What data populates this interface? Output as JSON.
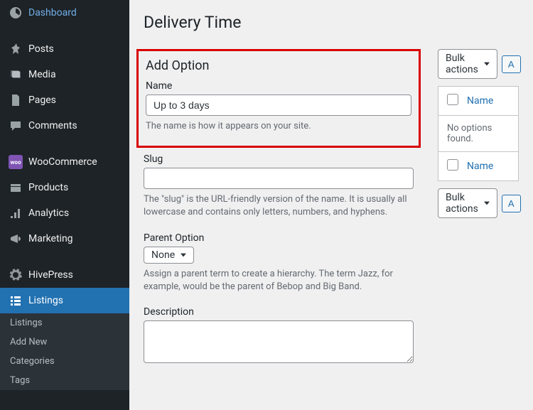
{
  "sidebar": {
    "items": [
      {
        "label": "Dashboard"
      },
      {
        "label": "Posts"
      },
      {
        "label": "Media"
      },
      {
        "label": "Pages"
      },
      {
        "label": "Comments"
      },
      {
        "label": "WooCommerce"
      },
      {
        "label": "Products"
      },
      {
        "label": "Analytics"
      },
      {
        "label": "Marketing"
      },
      {
        "label": "HivePress"
      },
      {
        "label": "Listings"
      }
    ],
    "sub": [
      {
        "label": "Listings"
      },
      {
        "label": "Add New"
      },
      {
        "label": "Categories"
      },
      {
        "label": "Tags"
      }
    ]
  },
  "page": {
    "title": "Delivery Time",
    "section_heading": "Add Option",
    "name_label": "Name",
    "name_value": "Up to 3 days",
    "name_help": "The name is how it appears on your site.",
    "slug_label": "Slug",
    "slug_value": "",
    "slug_help": "The \"slug\" is the URL-friendly version of the name. It is usually all lowercase and contains only letters, numbers, and hyphens.",
    "parent_label": "Parent Option",
    "parent_value": "None",
    "parent_help": "Assign a parent term to create a hierarchy. The term Jazz, for example, would be the parent of Bebop and Big Band.",
    "desc_label": "Description",
    "desc_value": ""
  },
  "right": {
    "bulk_label": "Bulk actions",
    "apply_label": "A",
    "name_col": "Name",
    "empty_text": "No options found."
  }
}
